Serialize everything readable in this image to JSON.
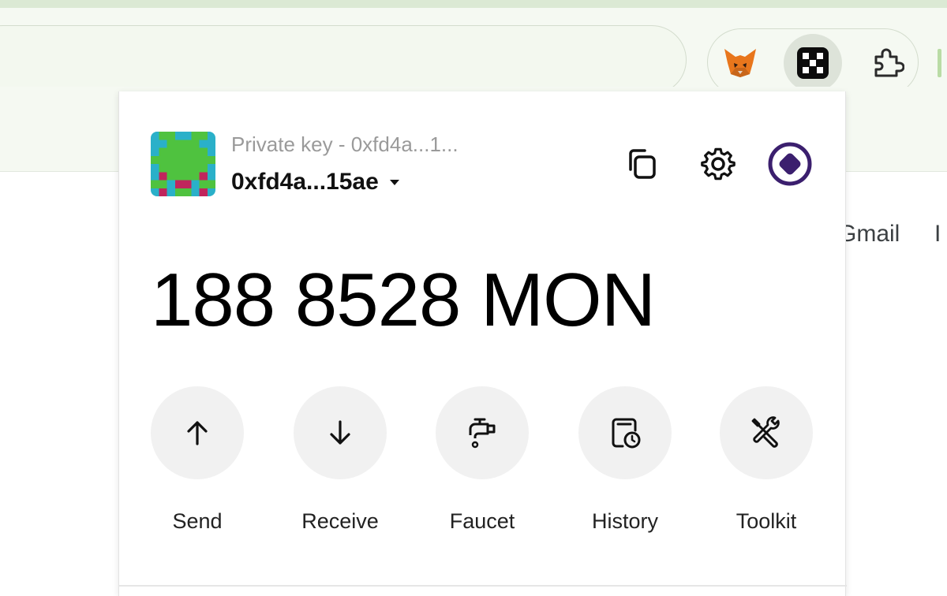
{
  "browser": {
    "extensions": [
      {
        "name": "fox-icon"
      },
      {
        "name": "wallet-extension-icon"
      },
      {
        "name": "puzzle-icon"
      }
    ],
    "page_links": [
      "Gmail",
      "I"
    ]
  },
  "wallet": {
    "account_subtitle": "Private key - 0xfd4a...1...",
    "account_address": "0xfd4a...15ae",
    "header_icons": [
      "copy-icon",
      "gear-icon",
      "network-logo-icon"
    ],
    "balance": "188 8528 MON",
    "actions": [
      {
        "label": "Send",
        "icon": "arrow-up-icon"
      },
      {
        "label": "Receive",
        "icon": "arrow-down-icon"
      },
      {
        "label": "Faucet",
        "icon": "faucet-icon"
      },
      {
        "label": "History",
        "icon": "history-icon"
      },
      {
        "label": "Toolkit",
        "icon": "tools-icon"
      }
    ],
    "colors": {
      "accent": "#3b1f6e",
      "action_bg": "#f1f1f1"
    }
  }
}
